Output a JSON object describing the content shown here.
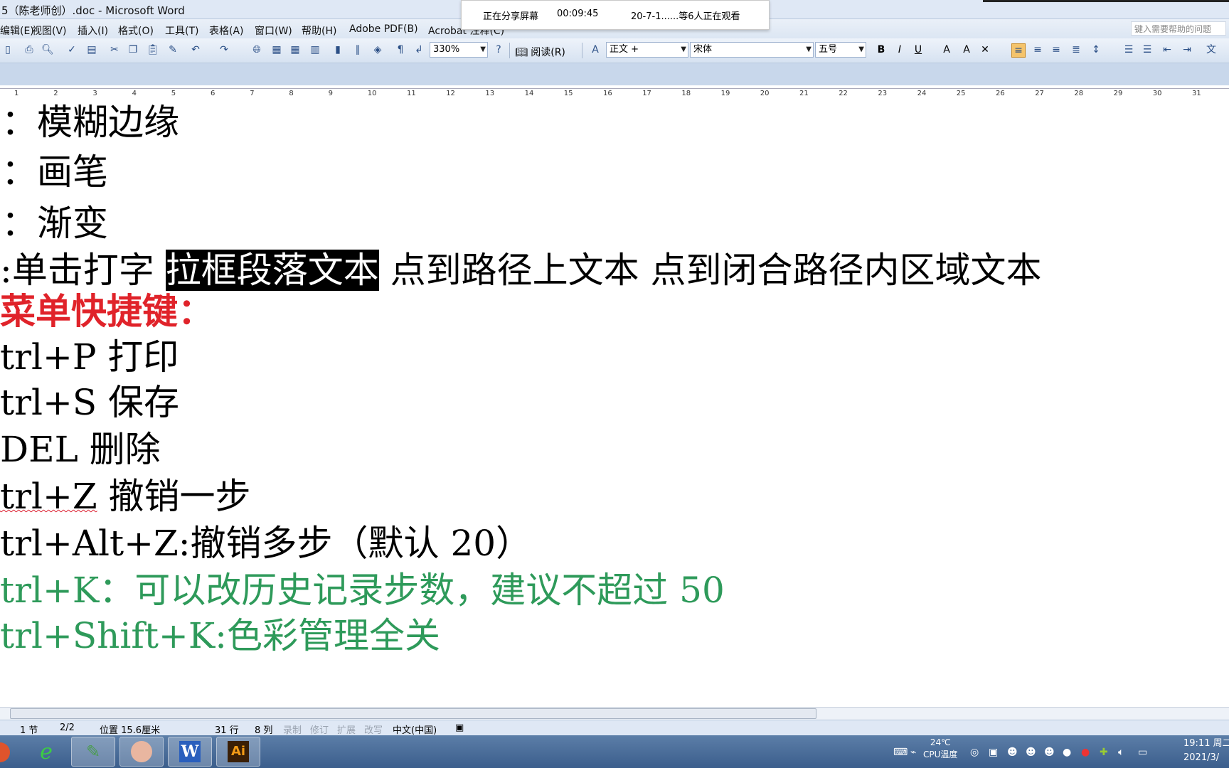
{
  "window": {
    "title": "5（陈老师创）.doc - Microsoft Word"
  },
  "share_banner": {
    "status": "正在分享屏幕",
    "timer": "00:09:45",
    "viewers": "20-7-1......等6人正在观看"
  },
  "menu": {
    "items": [
      "编辑(E)",
      "视图(V)",
      "插入(I)",
      "格式(O)",
      "工具(T)",
      "表格(A)",
      "窗口(W)",
      "帮助(H)",
      "Adobe PDF(B)",
      "Acrobat 注释(C)"
    ],
    "help_placeholder": "键入需要帮助的问题"
  },
  "toolbar": {
    "zoom": "330%",
    "read_label": "阅读(R)",
    "style": "正文 +",
    "font": "宋体",
    "size": "五号"
  },
  "ruler": {
    "marks": [
      "1",
      "2",
      "3",
      "4",
      "5",
      "6",
      "7",
      "8",
      "9",
      "10",
      "11",
      "12",
      "13",
      "14",
      "15",
      "16",
      "17",
      "18",
      "19",
      "20",
      "21",
      "22",
      "23",
      "24",
      "25",
      "26",
      "27",
      "28",
      "29",
      "30",
      "31"
    ]
  },
  "document": {
    "lines": [
      {
        "text": "：模糊边缘",
        "style": "normal"
      },
      {
        "text": "：画笔",
        "style": "normal"
      },
      {
        "text": "：渐变",
        "style": "normal"
      },
      {
        "text_before": ":单击打字  ",
        "highlight": "拉框段落文本",
        "text_after": "  点到路径上文本    点到闭合路径内区域文本",
        "style": "mixed"
      },
      {
        "text": "菜单快捷键：",
        "style": "red"
      },
      {
        "text": "trl+P 打印",
        "style": "normal"
      },
      {
        "text": "trl+S 保存",
        "style": "normal"
      },
      {
        "text": "DEL   删除",
        "style": "normal"
      },
      {
        "text_squiggle": "trl+Z",
        "text": " 撤销一步",
        "style": "squiggle"
      },
      {
        "text": "trl+Alt+Z:撤销多步（默认 20）",
        "style": "normal"
      },
      {
        "text": "trl+K：可以改历史记录步数，建议不超过 50",
        "style": "green"
      },
      {
        "text": "trl+Shift+K:色彩管理全关",
        "style": "green"
      }
    ]
  },
  "status": {
    "section": "1 节",
    "page": "2/2",
    "position": "位置 15.6厘米",
    "line": "31 行",
    "col": "8 列",
    "rec": "录制",
    "trk": "修订",
    "ext": "扩展",
    "ovr": "改写",
    "lang": "中文(中国)"
  },
  "taskbar": {
    "temp": "24℃",
    "cpu": "CPU温度",
    "time": "19:11 周二",
    "date": "2021/3/"
  },
  "colors": {
    "heading_red": "#e0232a",
    "green_text": "#2e9a5a",
    "highlight_bg": "#000000"
  }
}
